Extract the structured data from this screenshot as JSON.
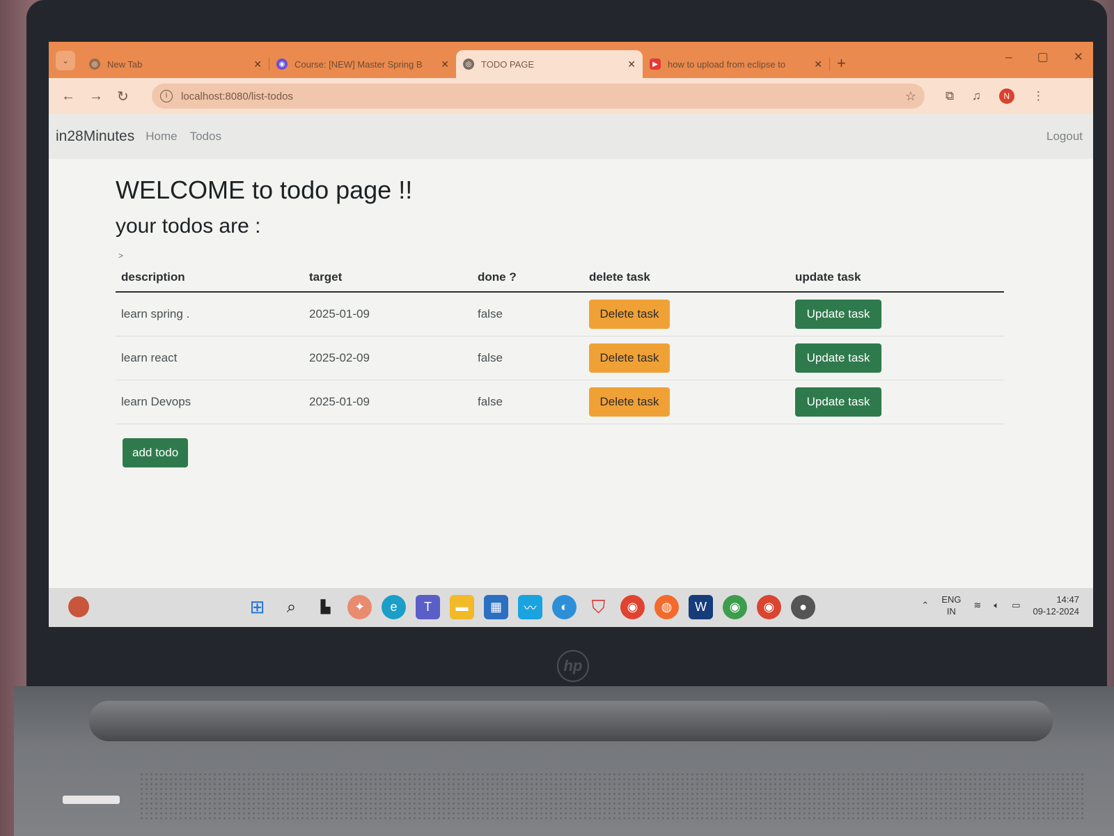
{
  "browser": {
    "tabs": [
      {
        "title": "New Tab",
        "active": false
      },
      {
        "title": "Course: [NEW] Master Spring B",
        "active": false
      },
      {
        "title": "TODO PAGE",
        "active": true
      },
      {
        "title": "how to upload from eclipse to",
        "active": false
      }
    ],
    "url": "localhost:8080/list-todos"
  },
  "navbar": {
    "brand": "in28Minutes",
    "links": [
      "Home",
      "Todos"
    ],
    "logout": "Logout"
  },
  "page": {
    "heading": "WELCOME to todo page !!",
    "subheading": "your todos are :",
    "marker": ">",
    "columns": [
      "description",
      "target",
      "done ?",
      "delete task",
      "update task"
    ],
    "rows": [
      {
        "description": "learn spring .",
        "target": "2025-01-09",
        "done": "false"
      },
      {
        "description": "learn react",
        "target": "2025-02-09",
        "done": "false"
      },
      {
        "description": "learn Devops",
        "target": "2025-01-09",
        "done": "false"
      }
    ],
    "delete_label": "Delete task",
    "update_label": "Update task",
    "add_label": "add todo"
  },
  "taskbar": {
    "language": "ENG",
    "region": "IN",
    "time": "14:47",
    "date": "09-12-2024"
  },
  "colors": {
    "tab_strip": "#ea8a4e",
    "delete_button": "#f0a136",
    "update_button": "#2f7a4c"
  }
}
